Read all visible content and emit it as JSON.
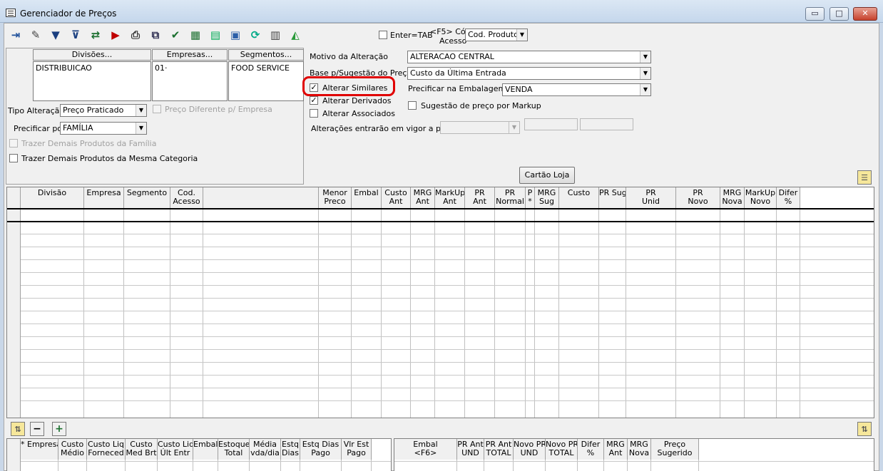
{
  "window": {
    "title": "Gerenciador de Preços",
    "min": "▭",
    "max": "□",
    "close": "✕"
  },
  "toolbar": {
    "icons": [
      "exit-icon",
      "edit-icon",
      "filter-icon",
      "filter-check-icon",
      "transfer-icon",
      "export-icon",
      "print-icon",
      "print-preview-icon",
      "approve-icon",
      "new-grid-icon",
      "spreadsheet-icon",
      "save-icon",
      "refresh-icon",
      "calculator-icon",
      "chart-icon"
    ],
    "enter_tab_label": "Enter=TAB",
    "f5_label": "<F5> Cód",
    "acesso_label": "Acesso",
    "codigo_combo": "Cod. Produto"
  },
  "filters": {
    "divisoes_header": "Divisões...",
    "empresas_header": "Empresas...",
    "segmentos_header": "Segmentos...",
    "divisoes_value": "DISTRIBUICAO",
    "empresas_value": "01·",
    "segmentos_value": "FOOD SERVICE",
    "tipo_alteracao_label": "Tipo Alteração",
    "tipo_alteracao_value": "Preço Praticado",
    "preco_diferente_label": "Preço Diferente p/ Empresa",
    "precificar_por_label": "Precificar por",
    "precificar_por_value": "FAMÍLIA",
    "trazer_familia_label": "Trazer Demais Produtos da Família",
    "trazer_categoria_label": "Trazer Demais Produtos da Mesma Categoria"
  },
  "options": {
    "motivo_label": "Motivo da Alteração",
    "motivo_value": "ALTERACAO CENTRAL",
    "base_label": "Base p/Sugestão do Preço",
    "base_value": "Custo da Última Entrada",
    "alterar_similares": "Alterar Similares",
    "alterar_derivados": "Alterar Derivados",
    "alterar_associados": "Alterar Associados",
    "precificar_embalagem_label": "Precificar na Embalagem",
    "precificar_embalagem_value": "VENDA",
    "sugestao_markup": "Sugestão de preço por Markup",
    "vigor_label": "Alterações entrarão em vigor a partir",
    "cartao_loja": "Cartão Loja"
  },
  "main_grid": {
    "columns": [
      {
        "l1": "Divisão",
        "l2": ""
      },
      {
        "l1": "Empresa",
        "l2": ""
      },
      {
        "l1": "Segmento",
        "l2": ""
      },
      {
        "l1": "Cod.",
        "l2": "Acesso"
      },
      {
        "l1": "",
        "l2": ""
      },
      {
        "l1": "Menor",
        "l2": "Preco"
      },
      {
        "l1": "Embal",
        "l2": ""
      },
      {
        "l1": "Custo",
        "l2": "Ant"
      },
      {
        "l1": "MRG",
        "l2": "Ant"
      },
      {
        "l1": "MarkUp",
        "l2": "Ant"
      },
      {
        "l1": "PR",
        "l2": "Ant"
      },
      {
        "l1": "PR",
        "l2": "Normal"
      },
      {
        "l1": "P",
        "l2": "*"
      },
      {
        "l1": "MRG",
        "l2": "Sug"
      },
      {
        "l1": "Custo",
        "l2": ""
      },
      {
        "l1": "PR Sug",
        "l2": ""
      },
      {
        "l1": "PR",
        "l2": "Unid"
      },
      {
        "l1": "PR",
        "l2": "Novo"
      },
      {
        "l1": "MRG",
        "l2": "Nova"
      },
      {
        "l1": "MarkUp",
        "l2": "Novo"
      },
      {
        "l1": "Difer",
        "l2": "%"
      }
    ]
  },
  "bottom_left_grid": {
    "columns": [
      {
        "l1": "* Empresa",
        "l2": ""
      },
      {
        "l1": "Custo",
        "l2": "Médio"
      },
      {
        "l1": "Custo Liq",
        "l2": "Forneced"
      },
      {
        "l1": "Custo",
        "l2": "Med Brt"
      },
      {
        "l1": "Custo Liq",
        "l2": "Últ Entr"
      },
      {
        "l1": "Embal",
        "l2": ""
      },
      {
        "l1": "Estoque",
        "l2": "Total"
      },
      {
        "l1": "Média",
        "l2": "vda/dia"
      },
      {
        "l1": "Estq",
        "l2": "Dias"
      },
      {
        "l1": "Estq Dias",
        "l2": "Pago"
      },
      {
        "l1": "Vlr Est",
        "l2": "Pago"
      }
    ]
  },
  "bottom_right_grid": {
    "columns": [
      {
        "l1": "Embal",
        "l2": "<F6>"
      },
      {
        "l1": "PR Ant",
        "l2": "UND"
      },
      {
        "l1": "PR Ant",
        "l2": "TOTAL"
      },
      {
        "l1": "Novo PR",
        "l2": "UND"
      },
      {
        "l1": "Novo PR",
        "l2": "TOTAL"
      },
      {
        "l1": "Difer",
        "l2": "%"
      },
      {
        "l1": "MRG",
        "l2": "Ant"
      },
      {
        "l1": "MRG",
        "l2": "Nova"
      },
      {
        "l1": "Preço",
        "l2": "Sugerido"
      }
    ]
  },
  "nav": {
    "minus": "−",
    "plus": "+"
  },
  "colors": {
    "highlight": "#e00000",
    "titlebar": "#c5d7ec"
  }
}
